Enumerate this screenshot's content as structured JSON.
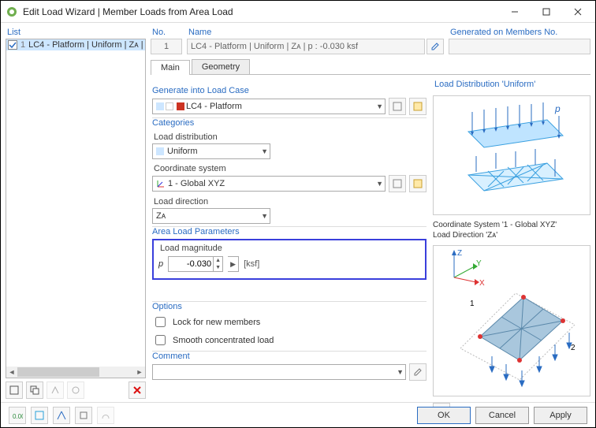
{
  "window": {
    "title": "Edit Load Wizard | Member Loads from Area Load"
  },
  "left": {
    "header": "List",
    "items": [
      {
        "index": "1",
        "text": "LC4 - Platform | Uniform | Zᴀ | p : -0.030 ksf"
      }
    ]
  },
  "top": {
    "no_label": "No.",
    "no_value": "1",
    "name_label": "Name",
    "name_value": "LC4 - Platform | Uniform | Zᴀ | p : -0.030 ksf",
    "gen_label": "Generated on Members No."
  },
  "tabs": {
    "main": "Main",
    "geometry": "Geometry"
  },
  "main": {
    "gen_case_title": "Generate into Load Case",
    "gen_case_value": "LC4 - Platform",
    "categories_title": "Categories",
    "load_dist_label": "Load distribution",
    "load_dist_value": "Uniform",
    "coord_sys_label": "Coordinate system",
    "coord_sys_value": "1 - Global XYZ",
    "load_dir_label": "Load direction",
    "load_dir_value": "Zᴀ",
    "params_title": "Area Load Parameters",
    "magnitude_label": "Load magnitude",
    "magnitude_symbol": "p",
    "magnitude_value": "-0.030",
    "magnitude_unit": "[ksf]",
    "options_title": "Options",
    "opt_lock": "Lock for new members",
    "opt_smooth": "Smooth concentrated load",
    "comment_title": "Comment"
  },
  "right": {
    "dist_title": "Load Distribution 'Uniform'",
    "dist_symbol": "p",
    "cs_title_1": "Coordinate System '1 - Global XYZ'",
    "cs_title_2": "Load Direction 'Zᴀ'",
    "axis_z": "Z",
    "axis_y": "Y",
    "axis_x": "X",
    "corner1": "1",
    "corner2": "2"
  },
  "footer": {
    "ok": "OK",
    "cancel": "Cancel",
    "apply": "Apply"
  },
  "chart_data": {
    "type": "diagram",
    "note": "schematic illustrations only; no quantitative axes",
    "load_magnitude_ksf": -0.03,
    "load_direction": "ZA",
    "coordinate_system": "1 - Global XYZ",
    "distribution": "Uniform"
  }
}
